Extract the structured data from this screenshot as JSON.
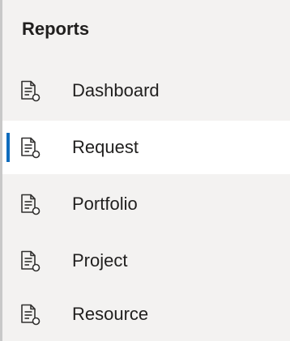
{
  "reports": {
    "title": "Reports",
    "items": [
      {
        "label": "Dashboard",
        "icon": "report-icon",
        "selected": false
      },
      {
        "label": "Request",
        "icon": "report-icon",
        "selected": true
      },
      {
        "label": "Portfolio",
        "icon": "report-icon",
        "selected": false
      },
      {
        "label": "Project",
        "icon": "report-icon",
        "selected": false
      },
      {
        "label": "Resource",
        "icon": "report-icon",
        "selected": false
      }
    ]
  },
  "colors": {
    "accent": "#0f6cbd",
    "background": "#f3f2f1",
    "selected_background": "#ffffff",
    "text": "#201f1e"
  }
}
